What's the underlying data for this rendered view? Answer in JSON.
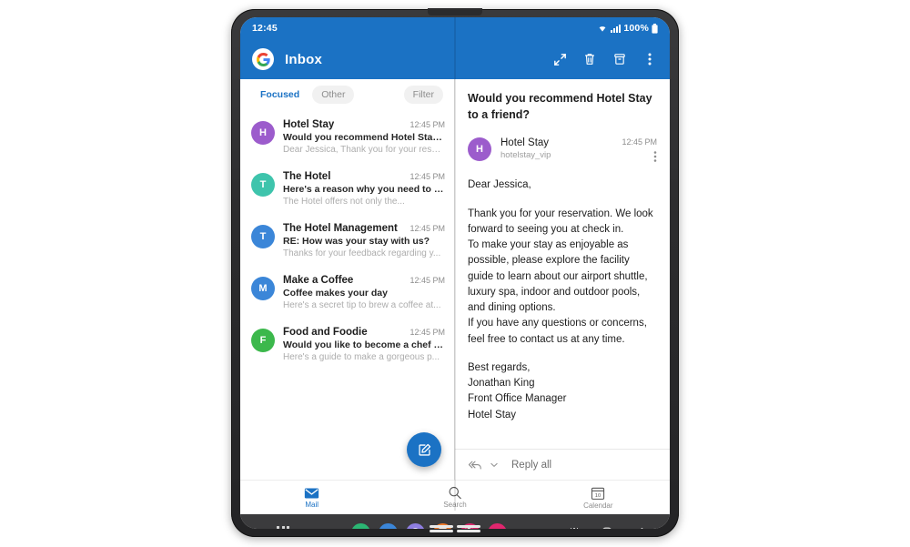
{
  "status_bar": {
    "time": "12:45",
    "battery_percent": "100%",
    "icons": [
      "wifi-icon",
      "cellular-signal-icon",
      "battery-icon"
    ]
  },
  "header": {
    "account_initial": "G",
    "title": "Inbox",
    "actions": [
      {
        "name": "expand-icon",
        "label": "Expand"
      },
      {
        "name": "delete-icon",
        "label": "Delete"
      },
      {
        "name": "archive-icon",
        "label": "Archive"
      },
      {
        "name": "more-options-icon",
        "label": "More options"
      }
    ]
  },
  "list_pane": {
    "tabs": [
      {
        "label": "Focused",
        "state": "active"
      },
      {
        "label": "Other",
        "state": "idle"
      }
    ],
    "filter_label": "Filter",
    "compose_label": "Compose",
    "messages": [
      {
        "initial": "H",
        "color": "#9c5ccc",
        "sender": "Hotel Stay",
        "time": "12:45 PM",
        "subject": "Would you recommend Hotel Stay to a fr...",
        "preview": "Dear Jessica, Thank you for your reser..."
      },
      {
        "initial": "T",
        "color": "#3ec4ac",
        "sender": "The Hotel",
        "time": "12:45 PM",
        "subject": "Here's a reason why you need to stay",
        "preview": "The Hotel offers not only the..."
      },
      {
        "initial": "T",
        "color": "#3b86d8",
        "sender": "The Hotel Management",
        "time": "12:45 PM",
        "subject": "RE: How was your stay with us?",
        "preview": "Thanks for your feedback regarding y..."
      },
      {
        "initial": "M",
        "color": "#3b86d8",
        "sender": "Make a Coffee",
        "time": "12:45 PM",
        "subject": "Coffee makes your day",
        "preview": "Here's a secret tip to brew a coffee at..."
      },
      {
        "initial": "F",
        "color": "#3cb84c",
        "sender": "Food and Foodie",
        "time": "12:45 PM",
        "subject": "Would you like to become a chef at you..",
        "preview": "Here's a guide to make a gorgeous p..."
      }
    ]
  },
  "reading_pane": {
    "subject": "Would you recommend Hotel Stay to a friend?",
    "from_initial": "H",
    "from_color": "#9c5ccc",
    "from_name": "Hotel Stay",
    "from_address": "hotelstay_vip",
    "time": "12:45 PM",
    "body_paragraphs": [
      "Dear Jessica,",
      "Thank you for your reservation. We look forward to seeing you at check in.\nTo make your stay as enjoyable as possible, please explore the facility guide to learn about our airport shuttle, luxury spa, indoor and outdoor pools, and dining options.\nIf you have any questions or concerns, feel free to contact us at any time.",
      "Best regards,\nJonathan King\nFront Office Manager\nHotel Stay"
    ],
    "reply_label": "Reply all"
  },
  "bottom_nav": [
    {
      "label": "Mail",
      "icon": "mail-icon",
      "state": "active"
    },
    {
      "label": "Search",
      "icon": "search-icon",
      "state": "idle"
    },
    {
      "label": "Calendar",
      "icon": "calendar-icon",
      "state": "idle",
      "day": "10"
    }
  ],
  "taskbar": {
    "apps_button": "all-apps-icon",
    "apps": [
      {
        "name": "phone-app-icon",
        "color": "#2bb673"
      },
      {
        "name": "messages-app-icon",
        "color": "#3b86d8"
      },
      {
        "name": "internet-app-icon",
        "color": "#8e7ee0"
      },
      {
        "name": "notes-app-icon",
        "color": "#f07a2a"
      },
      {
        "name": "gallery-app-icon",
        "color": "#e0266e"
      },
      {
        "name": "camera-app-icon",
        "color": "#e0266e"
      }
    ],
    "system_nav": [
      {
        "name": "recents-button"
      },
      {
        "name": "home-button"
      },
      {
        "name": "back-button"
      }
    ]
  },
  "theme": {
    "accent": "#1b72c4",
    "status_bar": "#1b72c4",
    "taskbar": "#3b3b3d"
  }
}
